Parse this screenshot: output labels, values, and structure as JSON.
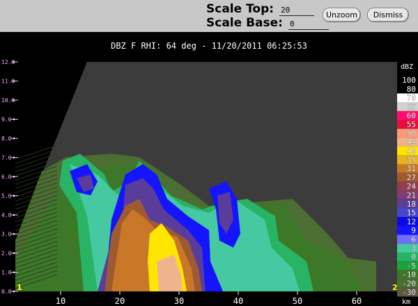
{
  "toolbar": {
    "scale_top_label": "Scale Top:",
    "scale_top_value": "20",
    "scale_base_label": "Scale Base:",
    "scale_base_value": "0",
    "unzoom_label": "Unzoom",
    "dismiss_label": "Dismiss"
  },
  "plot": {
    "title": "DBZ F  RHI: 64 deg  -  11/20/2011 06:25:53",
    "y_ticks": [
      "12.0",
      "11.0",
      "10.0",
      "9.0",
      "8.0",
      "7.0",
      "6.0",
      "5.0",
      "4.0",
      "3.0",
      "2.0",
      "1.0",
      "0.0"
    ],
    "x_ticks": [
      "10",
      "20",
      "30",
      "40",
      "50",
      "60"
    ],
    "x_unit": "km",
    "corner_left": "1",
    "corner_right": "2"
  },
  "colorbar": {
    "unit": "dBZ",
    "entries": [
      {
        "label": "100",
        "color": "#000000"
      },
      {
        "label": "80",
        "color": "#000000"
      },
      {
        "label": "70",
        "color": "#ffffff"
      },
      {
        "label": "65",
        "color": "#d2d2d2"
      },
      {
        "label": "60",
        "color": "#ff0a6e"
      },
      {
        "label": "55",
        "color": "#e60f3c"
      },
      {
        "label": "50",
        "color": "#ff9a78"
      },
      {
        "label": "45",
        "color": "#f0b48c"
      },
      {
        "label": "40",
        "color": "#ffe600"
      },
      {
        "label": "35",
        "color": "#e6b41e"
      },
      {
        "label": "31",
        "color": "#c87828"
      },
      {
        "label": "27",
        "color": "#a05a32"
      },
      {
        "label": "24",
        "color": "#963c50"
      },
      {
        "label": "21",
        "color": "#823c73"
      },
      {
        "label": "18",
        "color": "#5a3c9b"
      },
      {
        "label": "15",
        "color": "#4646c8"
      },
      {
        "label": "12",
        "color": "#0a0ae6"
      },
      {
        "label": "9",
        "color": "#1414ff"
      },
      {
        "label": "6",
        "color": "#6e6efa"
      },
      {
        "label": "3",
        "color": "#46c8a0"
      },
      {
        "label": "0",
        "color": "#28b464"
      },
      {
        "label": "-5",
        "color": "#1ea03c"
      },
      {
        "label": "-10",
        "color": "#3c7828"
      },
      {
        "label": "-20",
        "color": "#4b6e32"
      },
      {
        "label": "-30",
        "color": "#5a5a3c"
      }
    ]
  },
  "colors": {
    "background_echo": "#3c3c3c",
    "axis_text": "#ffffff",
    "y_tick_text": "#ffaaff",
    "corner_text": "#ffff00"
  }
}
